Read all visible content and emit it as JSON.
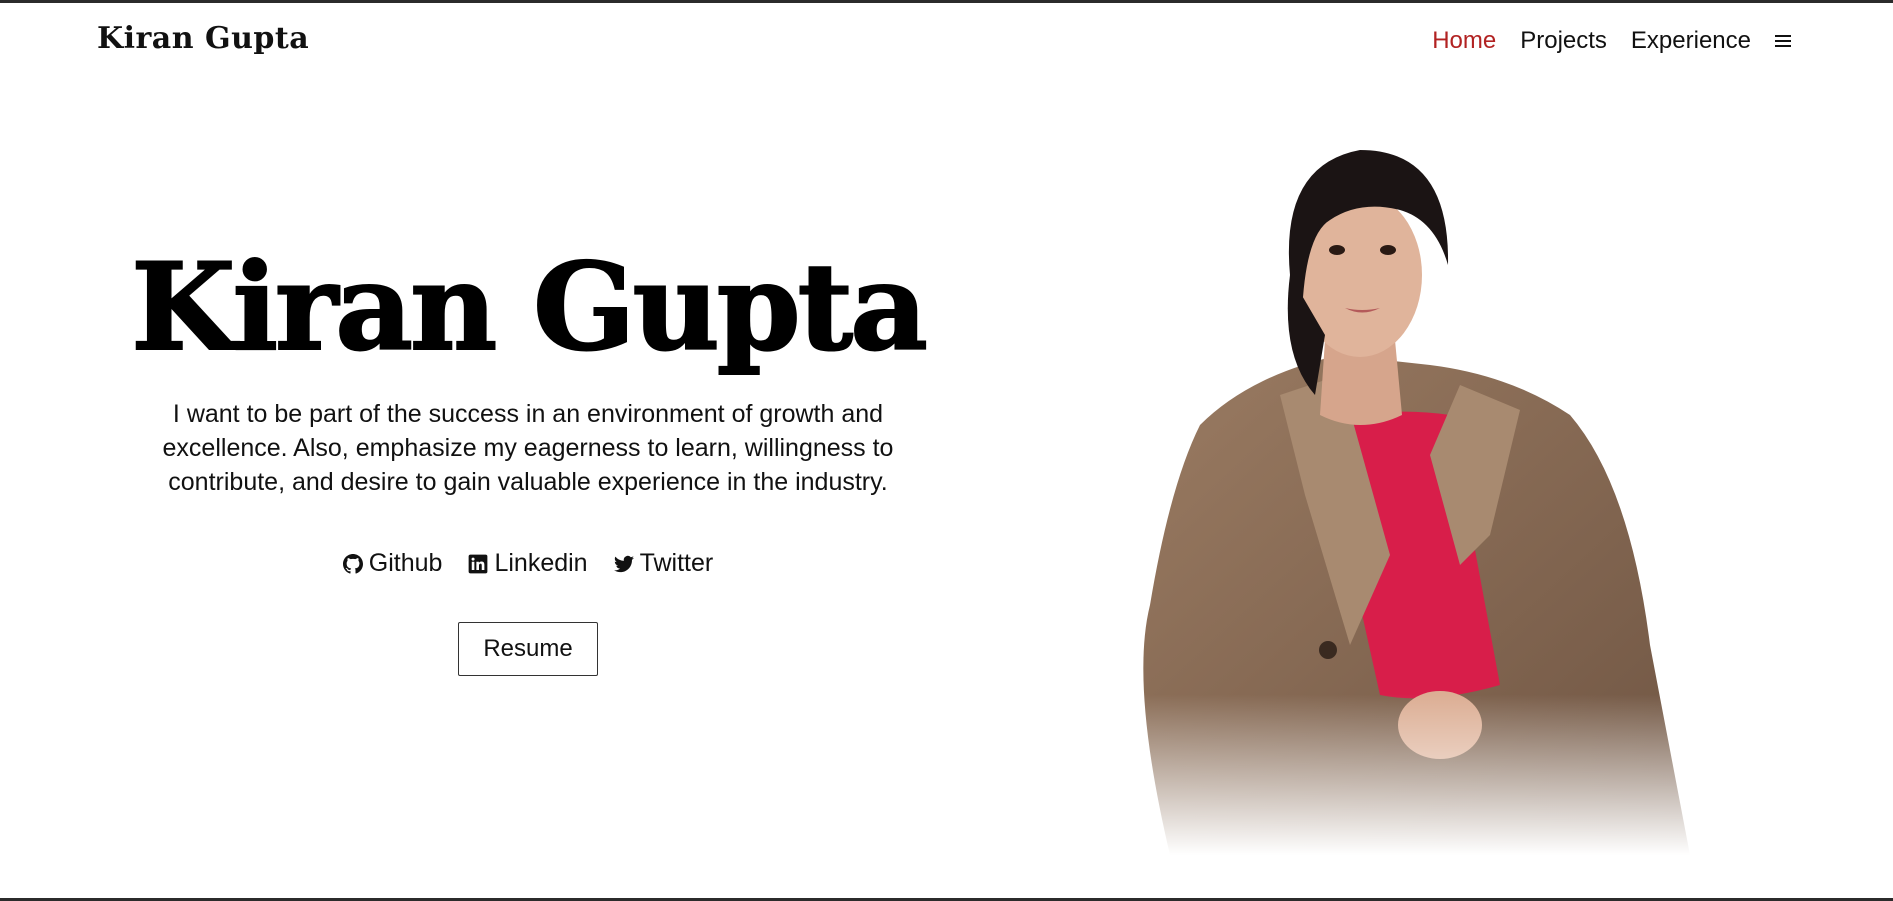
{
  "nav": {
    "brand": "Kiran Gupta",
    "links": [
      "Home",
      "Projects",
      "Experience"
    ],
    "active_color": "#b22222"
  },
  "hero": {
    "title": "Kiran Gupta",
    "tagline": "I want to be part of the success in an environment of growth and excellence. Also, emphasize my eagerness to learn, willingness to contribute, and desire to gain valuable experience in the industry.",
    "social": [
      {
        "label": "Github",
        "icon": "github-icon"
      },
      {
        "label": "Linkedin",
        "icon": "linkedin-icon"
      },
      {
        "label": "Twitter",
        "icon": "twitter-icon"
      }
    ],
    "resume_label": "Resume"
  },
  "portrait": {
    "subject": "profile photo",
    "jacket_color": "#8a6a52",
    "top_color": "#d81e4a",
    "hair_color": "#1b1414"
  }
}
